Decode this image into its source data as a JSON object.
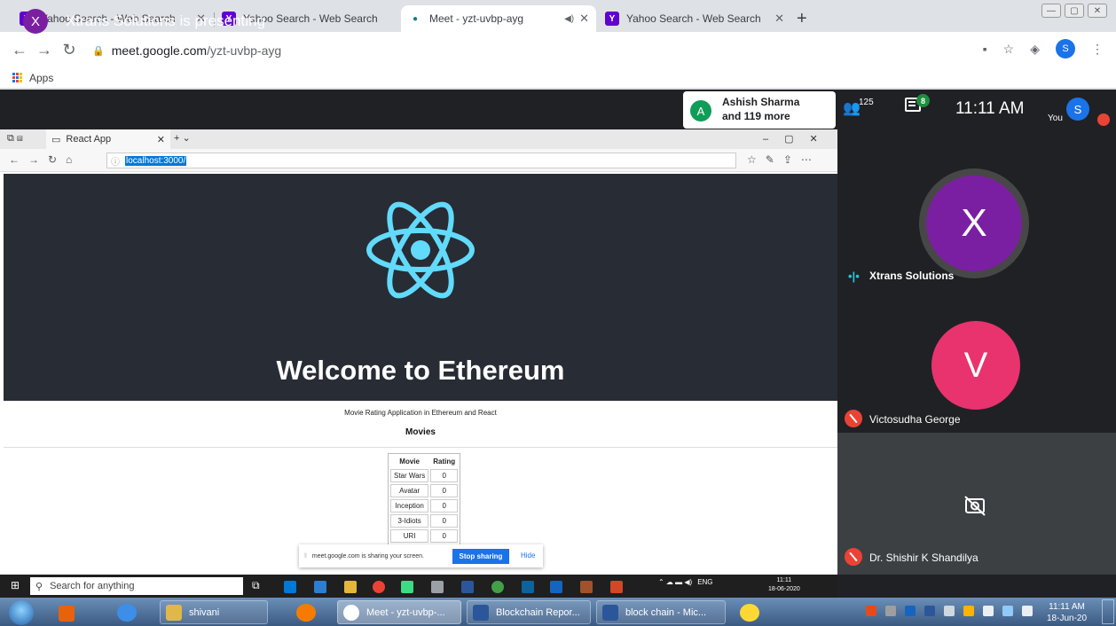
{
  "chrome": {
    "tabs": [
      {
        "title": "Yahoo Search - Web Search",
        "favicon": "yahoo-icon"
      },
      {
        "title": "Yahoo Search - Web Search",
        "favicon": "yahoo-icon"
      },
      {
        "title": "Meet - yzt-uvbp-ayg",
        "favicon": "meet-icon",
        "active": true,
        "audio": true
      },
      {
        "title": "Yahoo Search - Web Search",
        "favicon": "yahoo-icon"
      }
    ],
    "url_host": "meet.google.com",
    "url_path": "/yzt-uvbp-ayg",
    "bookmarks_apps": "Apps",
    "profile_initial": "S"
  },
  "meet": {
    "presenter_initial": "X",
    "presenting_text": "Xtrans Solutions is presenting",
    "card_initial": "A",
    "card_name": "Ashish Sharma",
    "card_more": "and 119 more",
    "people_count": "125",
    "chat_badge": "8",
    "time": "11:11 AM",
    "you_label": "You",
    "you_initial": "S",
    "participants": [
      {
        "initial": "X",
        "name": "Xtrans Solutions",
        "color": "#7b1fa2",
        "speaking": true
      },
      {
        "initial": "V",
        "name": "Victosudha George",
        "color": "#e8336e",
        "muted": true
      },
      {
        "name": "Dr. Shishir K Shandilya",
        "camera_off": true,
        "muted": true
      }
    ]
  },
  "shared_screen": {
    "tab_title": "React App",
    "url": "localhost:3000/",
    "heading": "Welcome to Ethereum",
    "subtitle": "Movie Rating Application in Ethereum and React",
    "section": "Movies",
    "table_headers": [
      "Movie",
      "Rating"
    ],
    "table_rows": [
      [
        "Star Wars",
        "0"
      ],
      [
        "Avatar",
        "0"
      ],
      [
        "Inception",
        "0"
      ],
      [
        "3-Idiots",
        "0"
      ],
      [
        "URI",
        "0"
      ]
    ],
    "share_notice": "meet.google.com is sharing your screen.",
    "stop_sharing": "Stop sharing",
    "hide": "Hide"
  },
  "inner_taskbar": {
    "search_placeholder": "Search for anything",
    "lang": "ENG",
    "time": "11:11",
    "date": "18-06-2020"
  },
  "taskbar": {
    "items": [
      {
        "label": "shivani",
        "color": "#e0b84a"
      },
      {
        "label": "Meet - yzt-uvbp-...",
        "color": "#ffffff",
        "active": true
      },
      {
        "label": "Blockchain Repor...",
        "color": "#2b579a"
      },
      {
        "label": "block chain - Mic...",
        "color": "#2b579a"
      }
    ],
    "time": "11:11 AM",
    "date": "18-Jun-20"
  }
}
